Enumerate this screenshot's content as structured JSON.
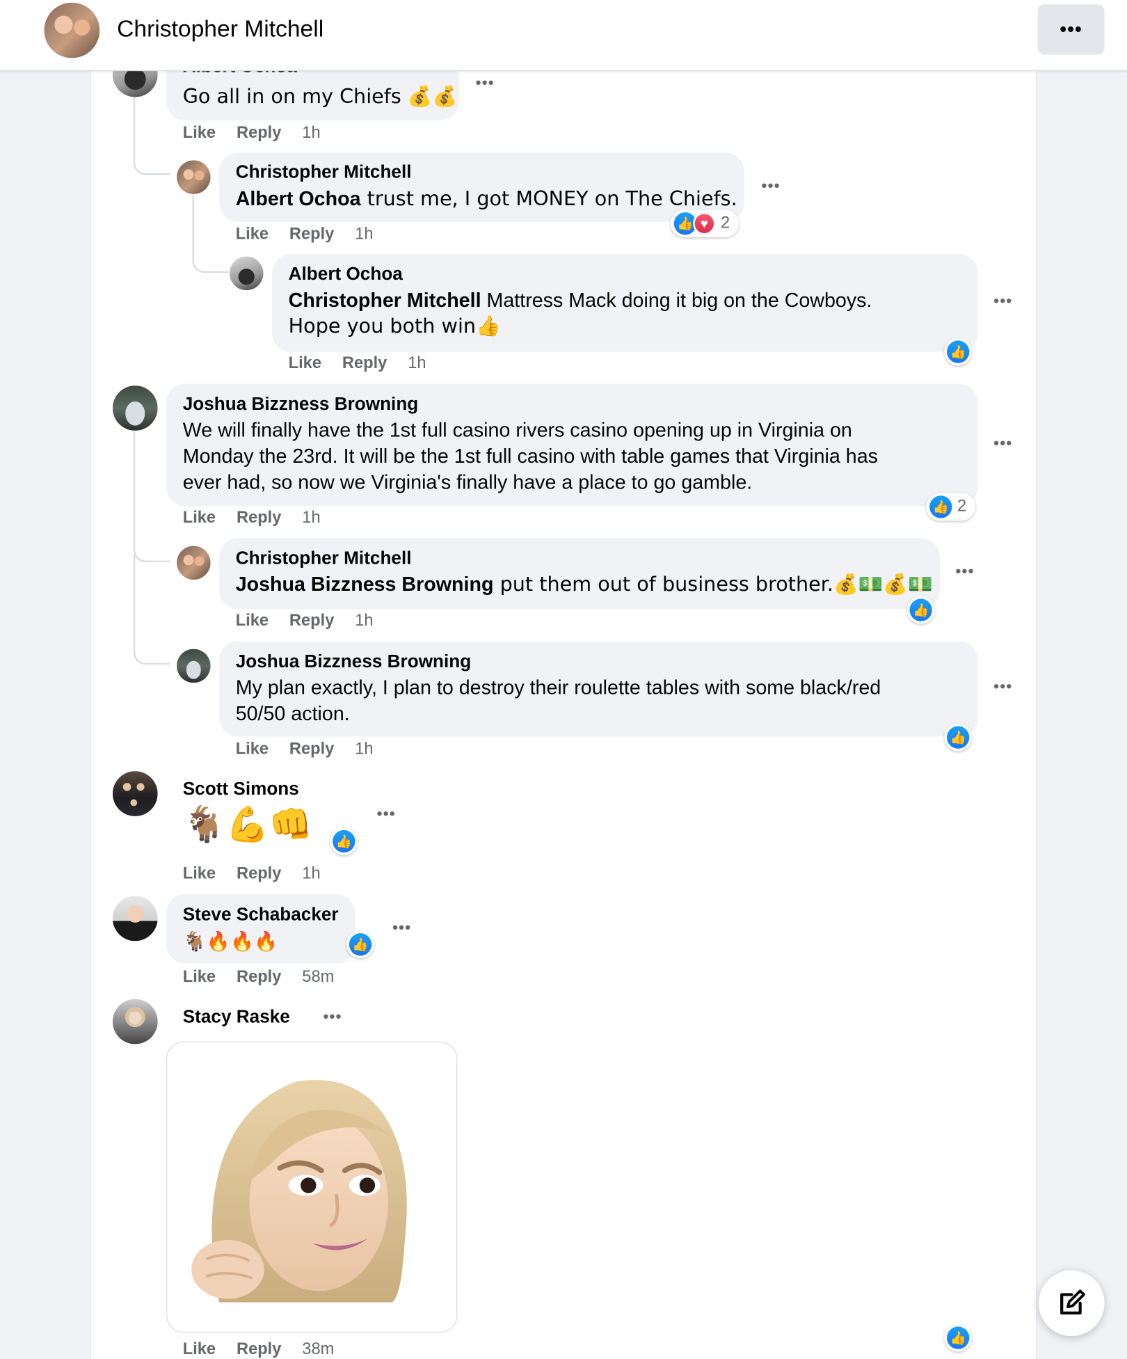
{
  "header": {
    "title": "Christopher Mitchell",
    "more_label": "•••"
  },
  "comments": [
    {
      "author": "Albert Ochoa",
      "text": "Go all in on my Chiefs 💰💰",
      "actions": {
        "like": "Like",
        "reply": "Reply",
        "time": "1h"
      }
    },
    {
      "author": "Christopher Mitchell",
      "mention": "Albert Ochoa",
      "text": " trust me, I got MONEY on The Chiefs.",
      "reaction_count": "2",
      "actions": {
        "like": "Like",
        "reply": "Reply",
        "time": "1h"
      }
    },
    {
      "author": "Albert Ochoa",
      "mention": "Christopher Mitchell",
      "text_line1": " Mattress Mack doing it big on the Cowboys.",
      "text_line2": "Hope you both win👍",
      "actions": {
        "like": "Like",
        "reply": "Reply",
        "time": "1h"
      }
    },
    {
      "author": "Joshua Bizzness Browning",
      "text_line1": "We will finally have the 1st full casino rivers casino opening up in Virginia on",
      "text_line2": "Monday the 23rd. It will be the 1st full casino with table games that Virginia has",
      "text_line3": "ever had, so now we Virginia's finally have a place to go gamble.",
      "reaction_count": "2",
      "actions": {
        "like": "Like",
        "reply": "Reply",
        "time": "1h"
      }
    },
    {
      "author": "Christopher Mitchell",
      "mention": "Joshua Bizzness Browning",
      "text": " put them out of business brother.💰💵💰💵",
      "actions": {
        "like": "Like",
        "reply": "Reply",
        "time": "1h"
      }
    },
    {
      "author": "Joshua Bizzness Browning",
      "text_line1": "My plan exactly, I plan to destroy their roulette tables with some black/red",
      "text_line2": "50/50 action.",
      "actions": {
        "like": "Like",
        "reply": "Reply",
        "time": "1h"
      }
    },
    {
      "author": "Scott Simons",
      "text": "🐐💪👊",
      "actions": {
        "like": "Like",
        "reply": "Reply",
        "time": "1h"
      }
    },
    {
      "author": "Steve Schabacker",
      "text": "🐐🔥🔥🔥",
      "actions": {
        "like": "Like",
        "reply": "Reply",
        "time": "58m"
      }
    },
    {
      "author": "Stacy Raske",
      "attachment": "memoji-sticker",
      "actions": {
        "like": "Like",
        "reply": "Reply",
        "time": "38m"
      }
    }
  ],
  "icons": {
    "like": "thumbs-up-icon",
    "love": "heart-icon",
    "compose": "compose-icon",
    "more": "more-dots-icon"
  },
  "colors": {
    "like_blue": "#1877f2",
    "love_red": "#f33e58",
    "bubble_bg": "#f0f2f5",
    "meta_gray": "#65676b"
  }
}
